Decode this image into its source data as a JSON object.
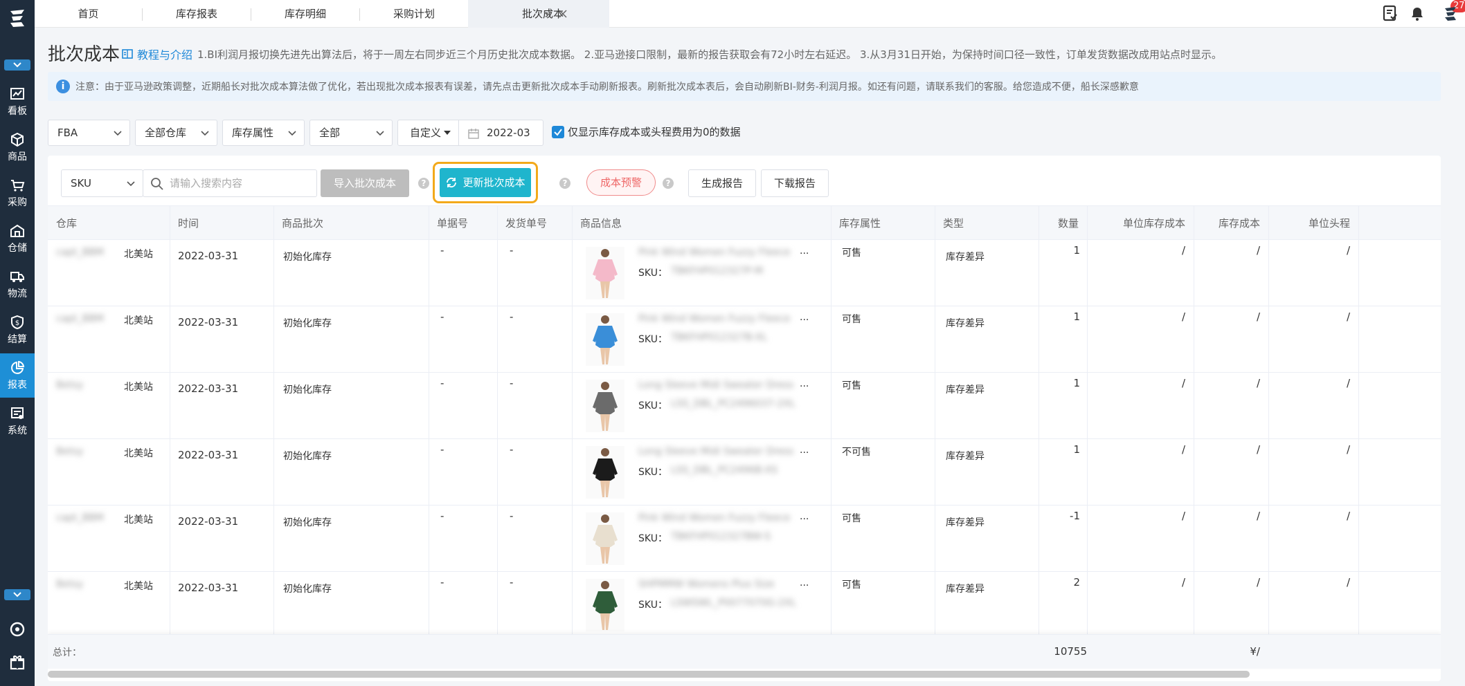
{
  "sidebar": {
    "items": [
      {
        "label": "看板",
        "icon": "chart-icon"
      },
      {
        "label": "商品",
        "icon": "cube-icon"
      },
      {
        "label": "采购",
        "icon": "cart-icon"
      },
      {
        "label": "仓储",
        "icon": "warehouse-icon"
      },
      {
        "label": "物流",
        "icon": "truck-icon"
      },
      {
        "label": "结算",
        "icon": "shield-money-icon"
      },
      {
        "label": "报表",
        "icon": "pie-chart-icon"
      },
      {
        "label": "系统",
        "icon": "system-icon"
      }
    ],
    "active_color": "#1e8fd6"
  },
  "tabs": [
    {
      "label": "首页"
    },
    {
      "label": "库存报表"
    },
    {
      "label": "库存明细"
    },
    {
      "label": "采购计划"
    },
    {
      "label": "批次成本"
    }
  ],
  "topbar": {
    "notification_count": "27"
  },
  "header": {
    "title": "批次成本",
    "guide_link": "教程与介绍",
    "desc": "1.BI利润月报切换先进先出算法后，将于一周左右同步近三个月历史批次成本数据。 2.亚马逊接口限制，最新的报告获取会有72小时左右延迟。 3.从3月31日开始，为保持时间口径一致性，订单发货数据改成用站点时显示。"
  },
  "notice": {
    "text": "注意：由于亚马逊政策调整，近期船长对批次成本算法做了优化，若出现批次成本报表有误差，请先点击更新批次成本手动刷新报表。刷新批次成本表后，会自动刷新BI-财务-利润月报。如还有问题，请联系我们的客服。给您造成不便，船长深感歉意"
  },
  "filters": {
    "fulfillment": "FBA",
    "warehouse": "全部仓库",
    "attribute": "库存属性",
    "scope": "全部",
    "custom": "自定义",
    "date": "2022-03",
    "only_zero_label": "仅显示库存成本或头程费用为0的数据"
  },
  "toolbar": {
    "search_field": "SKU",
    "search_placeholder": "请输入搜索内容",
    "import_label": "导入批次成本",
    "update_label": "更新批次成本",
    "warning_label": "成本预警",
    "generate_label": "生成报告",
    "download_label": "下载报告"
  },
  "table": {
    "columns": [
      "仓库",
      "时间",
      "商品批次",
      "单据号",
      "发货单号",
      "商品信息",
      "库存属性",
      "类型",
      "数量",
      "单位库存成本",
      "库存成本",
      "单位头程"
    ],
    "rows": [
      {
        "warehouse_blur": "capt_BBM",
        "warehouse": "北美站",
        "time": "2022-03-31",
        "batch": "初始化库存",
        "doc": "-",
        "ship": "-",
        "product_blur": "Pink Wind Women Fuzzy Fleece",
        "sku_label": "SKU：",
        "sku_blur": "TBKFHP012327P-M",
        "attr": "可售",
        "type": "库存差异",
        "qty": "1",
        "unit_cost": "/",
        "cost": "/",
        "unit_head": "/",
        "color": "#f4b9c9"
      },
      {
        "warehouse_blur": "capt_BBM",
        "warehouse": "北美站",
        "time": "2022-03-31",
        "batch": "初始化库存",
        "doc": "-",
        "ship": "-",
        "product_blur": "Pink Wind Women Fuzzy Fleece",
        "sku_label": "SKU：",
        "sku_blur": "TBKFHP012327B-XL",
        "attr": "可售",
        "type": "库存差异",
        "qty": "1",
        "unit_cost": "/",
        "cost": "/",
        "unit_head": "/",
        "color": "#3a8ed8"
      },
      {
        "warehouse_blur": "Betsy",
        "warehouse": "北美站",
        "time": "2022-03-31",
        "batch": "初始化库存",
        "doc": "-",
        "ship": "-",
        "product_blur": "Long Sleeve Midi Sweater Dress",
        "sku_label": "SKU：",
        "sku_blur": "LSS_DBL_PC2496037-2XL",
        "attr": "可售",
        "type": "库存差异",
        "qty": "1",
        "unit_cost": "/",
        "cost": "/",
        "unit_head": "/",
        "color": "#6b6b6b"
      },
      {
        "warehouse_blur": "Betsy",
        "warehouse": "北美站",
        "time": "2022-03-31",
        "batch": "初始化库存",
        "doc": "-",
        "ship": "-",
        "product_blur": "Long Sleeve Midi Sweater Dress",
        "sku_label": "SKU：",
        "sku_blur": "LSS_DBL_PC2496B-XS",
        "attr": "不可售",
        "type": "库存差异",
        "qty": "1",
        "unit_cost": "/",
        "cost": "/",
        "unit_head": "/",
        "color": "#1b1b1b"
      },
      {
        "warehouse_blur": "capt_BBM",
        "warehouse": "北美站",
        "time": "2022-03-31",
        "batch": "初始化库存",
        "doc": "-",
        "ship": "-",
        "product_blur": "Pink Wind Women Fuzzy Fleece",
        "sku_label": "SKU：",
        "sku_blur": "TBKFHP012327BW-S",
        "attr": "可售",
        "type": "库存差异",
        "qty": "-1",
        "unit_cost": "/",
        "cost": "/",
        "unit_head": "/",
        "color": "#e8dfcf"
      },
      {
        "warehouse_blur": "Betsy",
        "warehouse": "北美站",
        "time": "2022-03-31",
        "batch": "初始化库存",
        "doc": "-",
        "ship": "-",
        "product_blur": "SHPMMW Womens Plus Size",
        "sku_label": "SKU：",
        "sku_blur": "LSWSWL_P0077070G-2XL",
        "attr": "可售",
        "type": "库存差异",
        "qty": "2",
        "unit_cost": "/",
        "cost": "/",
        "unit_head": "/",
        "color": "#2f5d3a"
      }
    ],
    "footer": {
      "label": "总计：",
      "qty": "10755",
      "cost": "¥/"
    }
  }
}
